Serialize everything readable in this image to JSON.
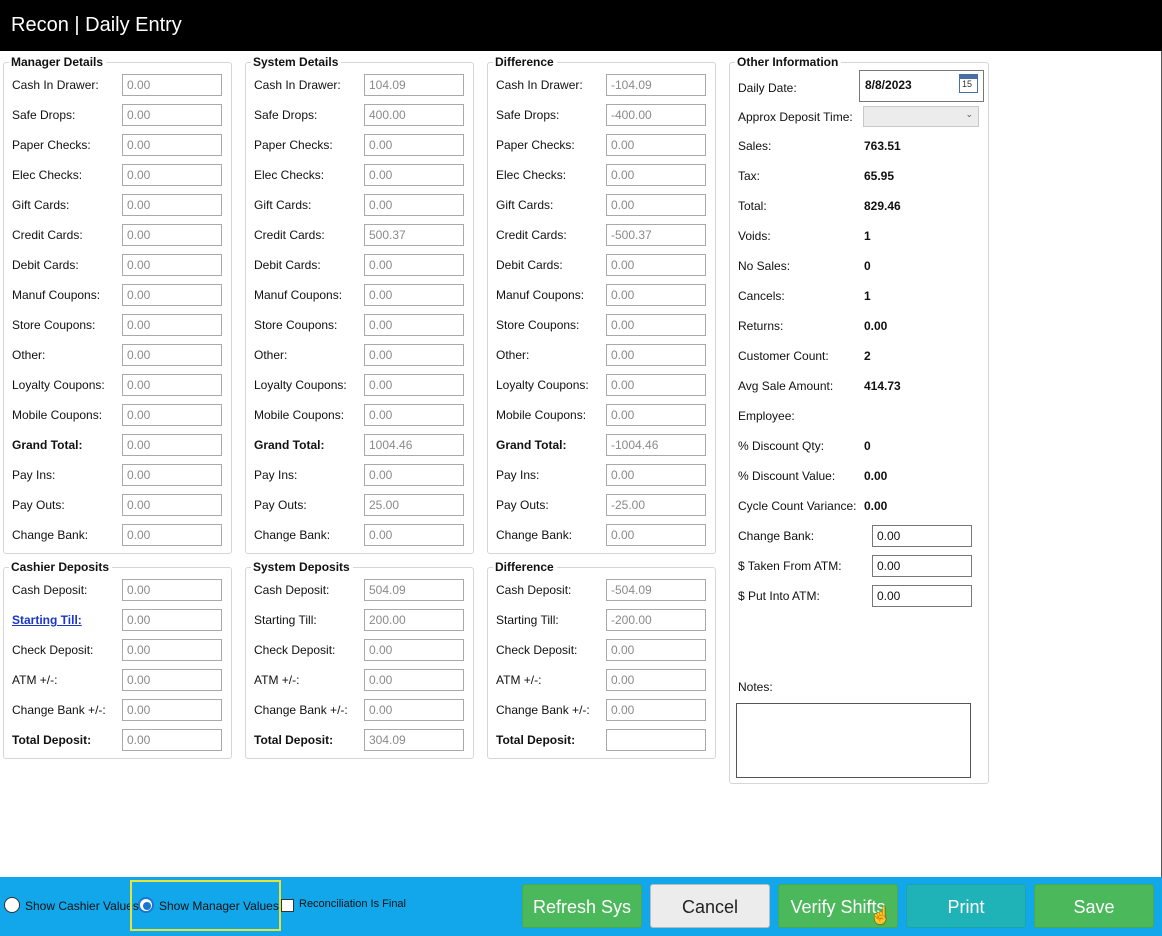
{
  "title": "Recon | Daily Entry",
  "manager": {
    "title": "Manager Details",
    "rows": [
      {
        "label": "Cash In Drawer:",
        "value": "0.00"
      },
      {
        "label": "Safe Drops:",
        "value": "0.00"
      },
      {
        "label": "Paper Checks:",
        "value": "0.00"
      },
      {
        "label": "Elec Checks:",
        "value": "0.00"
      },
      {
        "label": "Gift Cards:",
        "value": "0.00"
      },
      {
        "label": "Credit Cards:",
        "value": "0.00"
      },
      {
        "label": "Debit Cards:",
        "value": "0.00"
      },
      {
        "label": "Manuf Coupons:",
        "value": "0.00"
      },
      {
        "label": "Store Coupons:",
        "value": "0.00"
      },
      {
        "label": "Other:",
        "value": "0.00"
      },
      {
        "label": "Loyalty Coupons:",
        "value": "0.00"
      },
      {
        "label": "Mobile Coupons:",
        "value": "0.00"
      },
      {
        "label": "Grand Total:",
        "value": "0.00"
      },
      {
        "label": "Pay Ins:",
        "value": "0.00"
      },
      {
        "label": "Pay Outs:",
        "value": "0.00"
      },
      {
        "label": "Change Bank:",
        "value": "0.00"
      }
    ]
  },
  "system": {
    "title": "System Details",
    "rows": [
      {
        "label": "Cash In Drawer:",
        "value": "104.09"
      },
      {
        "label": "Safe Drops:",
        "value": "400.00"
      },
      {
        "label": "Paper Checks:",
        "value": "0.00"
      },
      {
        "label": "Elec Checks:",
        "value": "0.00"
      },
      {
        "label": "Gift Cards:",
        "value": "0.00"
      },
      {
        "label": "Credit Cards:",
        "value": "500.37"
      },
      {
        "label": "Debit Cards:",
        "value": "0.00"
      },
      {
        "label": "Manuf Coupons:",
        "value": "0.00"
      },
      {
        "label": "Store Coupons:",
        "value": "0.00"
      },
      {
        "label": "Other:",
        "value": "0.00"
      },
      {
        "label": "Loyalty Coupons:",
        "value": "0.00"
      },
      {
        "label": "Mobile Coupons:",
        "value": "0.00"
      },
      {
        "label": "Grand Total:",
        "value": "1004.46"
      },
      {
        "label": "Pay Ins:",
        "value": "0.00"
      },
      {
        "label": "Pay Outs:",
        "value": "25.00"
      },
      {
        "label": "Change Bank:",
        "value": "0.00"
      }
    ]
  },
  "difference": {
    "title": "Difference",
    "rows": [
      {
        "label": "Cash In Drawer:",
        "value": "-104.09"
      },
      {
        "label": "Safe Drops:",
        "value": "-400.00"
      },
      {
        "label": "Paper Checks:",
        "value": "0.00"
      },
      {
        "label": "Elec Checks:",
        "value": "0.00"
      },
      {
        "label": "Gift Cards:",
        "value": "0.00"
      },
      {
        "label": "Credit Cards:",
        "value": "-500.37"
      },
      {
        "label": "Debit Cards:",
        "value": "0.00"
      },
      {
        "label": "Manuf Coupons:",
        "value": "0.00"
      },
      {
        "label": "Store Coupons:",
        "value": "0.00"
      },
      {
        "label": "Other:",
        "value": "0.00"
      },
      {
        "label": "Loyalty Coupons:",
        "value": "0.00"
      },
      {
        "label": "Mobile Coupons:",
        "value": "0.00"
      },
      {
        "label": "Grand Total:",
        "value": "-1004.46"
      },
      {
        "label": "Pay Ins:",
        "value": "0.00"
      },
      {
        "label": "Pay Outs:",
        "value": "-25.00"
      },
      {
        "label": "Change Bank:",
        "value": "0.00"
      }
    ]
  },
  "cashier_deposits": {
    "title": "Cashier Deposits",
    "rows": [
      {
        "label": "Cash Deposit:",
        "value": "0.00"
      },
      {
        "label": "Starting Till:",
        "value": "0.00"
      },
      {
        "label": "Check Deposit:",
        "value": "0.00"
      },
      {
        "label": "ATM +/-:",
        "value": "0.00"
      },
      {
        "label": "Change Bank +/-:",
        "value": "0.00"
      },
      {
        "label": "Total Deposit:",
        "value": "0.00"
      }
    ]
  },
  "system_deposits": {
    "title": "System Deposits",
    "rows": [
      {
        "label": "Cash Deposit:",
        "value": "504.09"
      },
      {
        "label": "Starting Till:",
        "value": "200.00"
      },
      {
        "label": "Check Deposit:",
        "value": "0.00"
      },
      {
        "label": "ATM +/-:",
        "value": "0.00"
      },
      {
        "label": "Change Bank +/-:",
        "value": "0.00"
      },
      {
        "label": "Total Deposit:",
        "value": "304.09"
      }
    ]
  },
  "difference_deposits": {
    "title": "Difference",
    "rows": [
      {
        "label": "Cash Deposit:",
        "value": "-504.09"
      },
      {
        "label": "Starting Till:",
        "value": "-200.00"
      },
      {
        "label": "Check Deposit:",
        "value": "0.00"
      },
      {
        "label": "ATM +/-:",
        "value": "0.00"
      },
      {
        "label": "Change Bank +/-:",
        "value": "0.00"
      },
      {
        "label": "Total Deposit:",
        "value": ""
      }
    ]
  },
  "other": {
    "title": "Other Information",
    "daily_date_label": "Daily Date:",
    "daily_date": "8/8/2023",
    "calendar_day": "15",
    "deposit_time_label": "Approx Deposit Time:",
    "deposit_time_value": "",
    "stats": [
      {
        "label": "Sales:",
        "value": "763.51"
      },
      {
        "label": "Tax:",
        "value": "65.95"
      },
      {
        "label": "Total:",
        "value": "829.46"
      },
      {
        "label": "Voids:",
        "value": "1"
      },
      {
        "label": "No Sales:",
        "value": "0"
      },
      {
        "label": "Cancels:",
        "value": "1"
      },
      {
        "label": "Returns:",
        "value": "0.00"
      },
      {
        "label": "Customer Count:",
        "value": "2"
      },
      {
        "label": "Avg Sale Amount:",
        "value": "414.73"
      },
      {
        "label": "Employee:",
        "value": ""
      },
      {
        "label": "% Discount Qty:",
        "value": "0"
      },
      {
        "label": "% Discount Value:",
        "value": "0.00"
      },
      {
        "label": "Cycle Count Variance:",
        "value": "0.00"
      }
    ],
    "inputs": [
      {
        "label": "Change Bank:",
        "value": "0.00"
      },
      {
        "label": "$ Taken From ATM:",
        "value": "0.00"
      },
      {
        "label": "$ Put Into ATM:",
        "value": "0.00"
      }
    ],
    "notes_label": "Notes:",
    "notes_value": ""
  },
  "footer": {
    "show_cashier_label": "Show Cashier Values",
    "show_manager_label": "Show Manager Values",
    "final_label": "Reconciliation Is Final",
    "selected_view": "manager",
    "final_checked": false,
    "buttons": {
      "refresh": "Refresh Sys",
      "cancel": "Cancel",
      "verify": "Verify Shifts",
      "print": "Print",
      "save": "Save"
    }
  },
  "colors": {
    "bottom_bar": "#11a7ea",
    "green_button": "#4cb85c",
    "teal_button": "#1fb3b8",
    "cancel_button": "#ececec",
    "highlight": "#e6e33a",
    "link": "#1a35c9"
  }
}
